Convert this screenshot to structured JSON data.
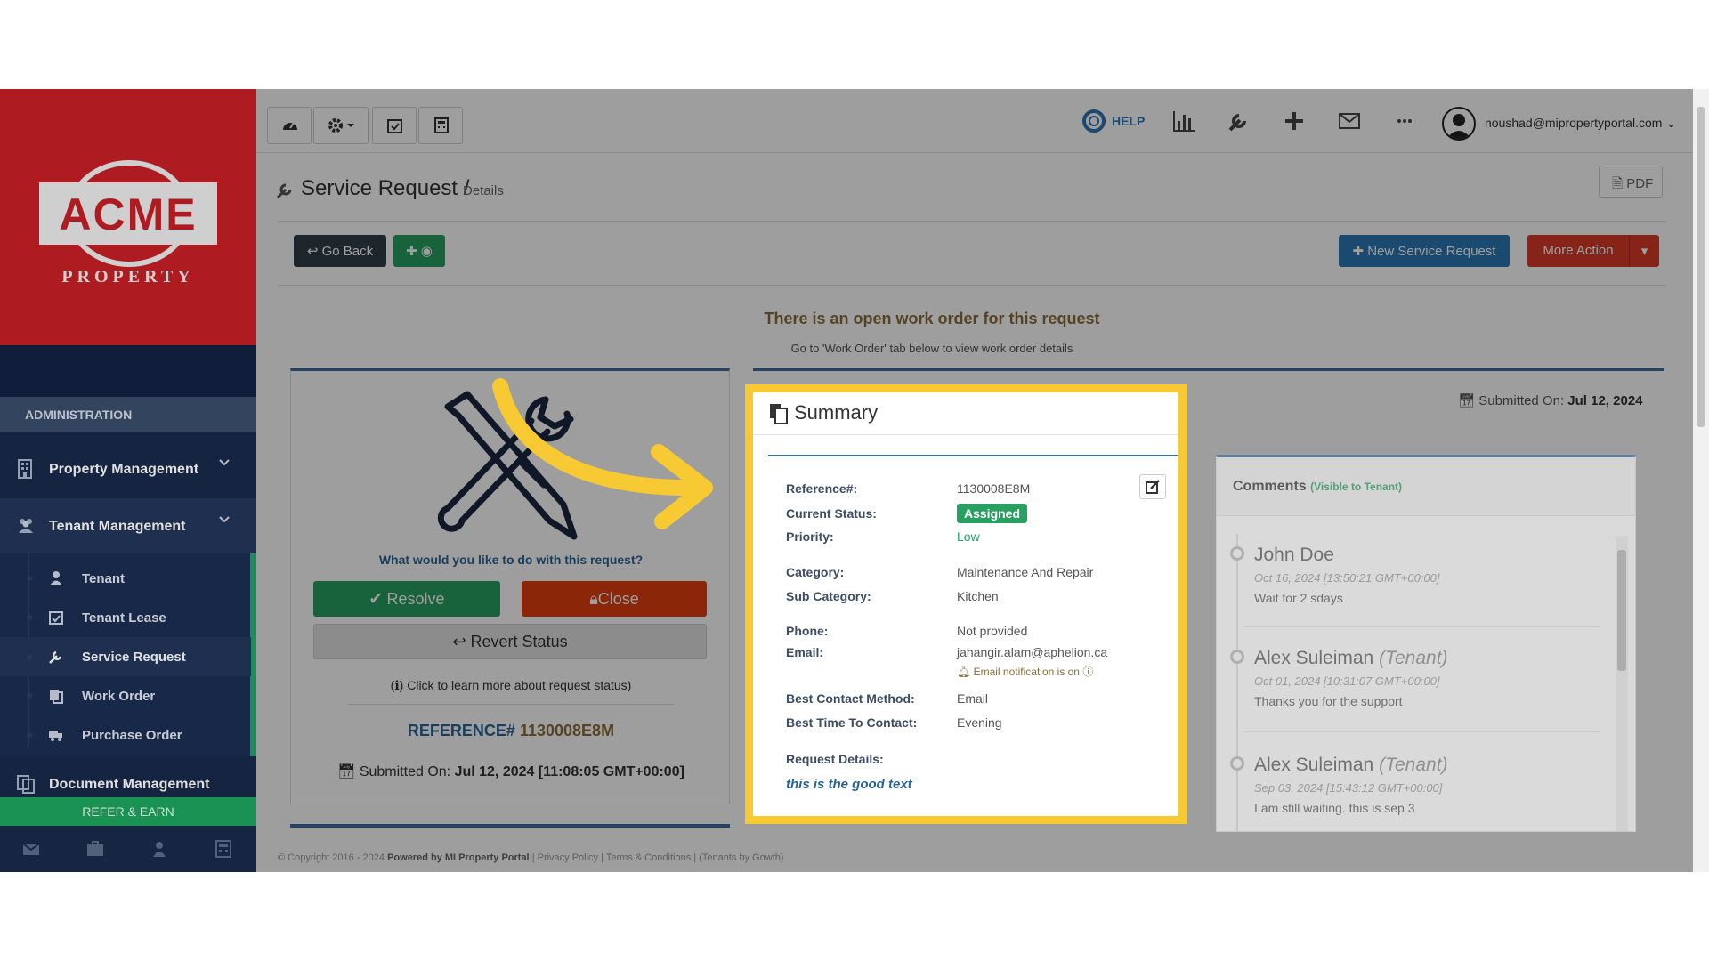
{
  "brand": {
    "name": "ACME",
    "tagline": "PROPERTY",
    "accent": "#c72026"
  },
  "sidebar": {
    "section": "ADMINISTRATION",
    "items": [
      {
        "label": "Property Management",
        "icon": "building-icon"
      },
      {
        "label": "Tenant Management",
        "icon": "users-icon"
      },
      {
        "label": "Document Management",
        "icon": "documents-icon"
      }
    ],
    "sub_items": [
      {
        "label": "Tenant",
        "icon": "user-icon"
      },
      {
        "label": "Tenant Lease",
        "icon": "calendar-check-icon"
      },
      {
        "label": "Service Request",
        "icon": "wrench-icon"
      },
      {
        "label": "Work Order",
        "icon": "copy-icon"
      },
      {
        "label": "Purchase Order",
        "icon": "truck-icon"
      }
    ],
    "refer": "REFER & EARN"
  },
  "topbar": {
    "help": "HELP",
    "user_email": "noushad@mipropertyportal.com"
  },
  "page": {
    "title": "Service Request",
    "separator": "/",
    "subtitle": "Details",
    "pdf": "PDF",
    "go_back": "Go Back",
    "new_request": "New Service Request",
    "more_action": "More Action",
    "notice_title": "There is an open work order for this request",
    "notice_sub": "Go to 'Work Order' tab below to view work order details"
  },
  "left_card": {
    "question": "What would you like to do with this request?",
    "resolve": "Resolve",
    "close": "Close",
    "revert": "Revert Status",
    "learn": "Click to learn more about request status)",
    "ref_label": "REFERENCE#",
    "ref_value": "1130008E8M",
    "submitted_label": "Submitted On:",
    "submitted_value": "Jul 12, 2024 [11:08:05 GMT+00:00]"
  },
  "summary": {
    "title": "Summary",
    "submitted_label": "Submitted On:",
    "submitted_value": "Jul 12, 2024",
    "fields": {
      "reference_label": "Reference#:",
      "reference_value": "1130008E8M",
      "status_label": "Current Status:",
      "status_value": "Assigned",
      "priority_label": "Priority:",
      "priority_value": "Low",
      "category_label": "Category:",
      "category_value": "Maintenance And Repair",
      "subcategory_label": "Sub Category:",
      "subcategory_value": "Kitchen",
      "phone_label": "Phone:",
      "phone_value": "Not provided",
      "email_label": "Email:",
      "email_value": "jahangir.alam@aphelion.ca",
      "email_note": "Email notification is on",
      "method_label": "Best Contact Method:",
      "method_value": "Email",
      "time_label": "Best Time To Contact:",
      "time_value": "Evening",
      "details_label": "Request Details:",
      "details_value": "this is the good text"
    }
  },
  "comments": {
    "title": "Comments",
    "visibility": "(Visible to Tenant)",
    "items": [
      {
        "name": "John Doe",
        "role": "",
        "date": "Oct 16, 2024 [13:50:21 GMT+00:00]",
        "text": "Wait for 2 sdays"
      },
      {
        "name": "Alex Suleiman",
        "role": "(Tenant)",
        "date": "Oct 01, 2024 [10:31:07 GMT+00:00]",
        "text": "Thanks you for the support"
      },
      {
        "name": "Alex Suleiman",
        "role": "(Tenant)",
        "date": "Sep 03, 2024 [15:43:12 GMT+00:00]",
        "text": "I am still waiting. this is sep 3"
      }
    ]
  },
  "footer": {
    "copyright": "© Copyright 2016 - 2024",
    "powered": "Powered by MI Property Portal",
    "links": "| Privacy Policy | Terms & Conditions |",
    "tenants": "(Tenants by Gowth)"
  },
  "colors": {
    "highlight": "#f7c932",
    "success": "#27a062",
    "danger": "#e0400d",
    "primary": "#3275b3"
  }
}
